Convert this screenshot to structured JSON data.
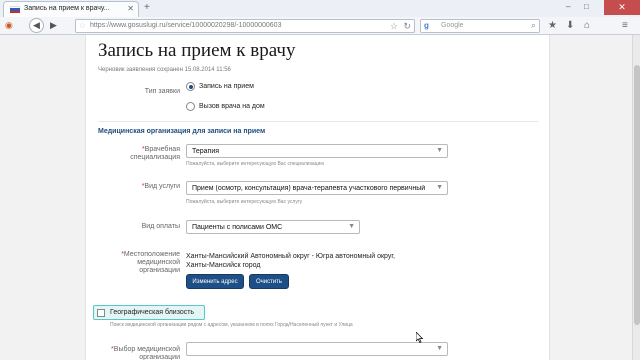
{
  "browser": {
    "tab_title": "Запись на прием к врачу...",
    "tab_close": "✕",
    "new_tab": "+",
    "url": "https://www.gosuslugi.ru/service/10000020298/-10000000603",
    "search_placeholder": "Google",
    "search_engine": "g",
    "back_glyph": "◀",
    "forward_glyph": "▶",
    "reload_glyph": "↻",
    "star_glyph": "☆",
    "search_go_glyph": "🔍",
    "minimize_glyph": "–",
    "maximize_glyph": "□",
    "close_glyph": "✕",
    "app_menu_glyph": "≡",
    "download_glyph": "⬇",
    "home_glyph": "⌂",
    "bookmark_glyph": "★",
    "flag_colors": [
      "#ffffff",
      "#2d5bbf",
      "#d52b1e"
    ],
    "accent_close": "#c54d4d"
  },
  "page": {
    "title": "Запись на прием к врачу",
    "draft_saved": "Черновик заявления сохранен 15.08.2014 11:56",
    "request_type": {
      "label": "Тип заявки",
      "options": [
        {
          "label": "Запись на прием",
          "selected": true
        },
        {
          "label": "Вызов врача на дом",
          "selected": false
        }
      ]
    },
    "section_title": "Медицинская организация для записи на прием",
    "specialization": {
      "label": "Врачебная специализация",
      "required_mark": "*",
      "value": "Терапия",
      "hint": "Пожалуйста, выберите интересующую Вас специализацию"
    },
    "service": {
      "label": "Вид услуги",
      "required_mark": "*",
      "value": "Прием (осмотр, консультация) врача-терапевта участкового первичный",
      "hint": "Пожалуйста, выберите интересующую Вас услугу"
    },
    "payment": {
      "label": "Вид оплаты",
      "value": "Пациенты с полисами ОМС"
    },
    "location": {
      "label": "Местоположение медицинской организации",
      "required_mark": "*",
      "value": "Ханты-Мансийский Автономный округ - Югра автономный округ, Ханты-Мансийск город",
      "change_button": "Изменить адрес",
      "clear_button": "Очистить"
    },
    "geo_proximity": {
      "label": "Географическая близость",
      "checked": false,
      "hint": "Поиск медицинской организации рядом с адресом, указанном в полях Город/Населенный пункт и Улица"
    },
    "med_org": {
      "label": "Выбор медицинской организации",
      "required_mark": "*",
      "value": ""
    },
    "select_arrow": "▼",
    "accent": "#1e4f87",
    "section_color": "#1e4c80"
  }
}
